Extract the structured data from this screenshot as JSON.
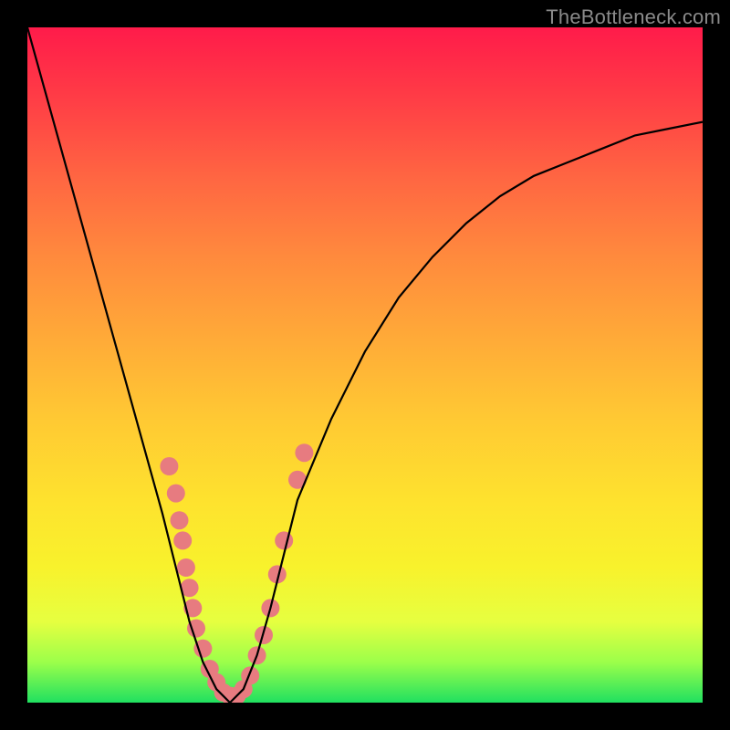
{
  "watermark": "TheBottleneck.com",
  "chart_data": {
    "type": "line",
    "title": "",
    "xlabel": "",
    "ylabel": "",
    "xlim": [
      0,
      100
    ],
    "ylim": [
      0,
      100
    ],
    "x": [
      0,
      5,
      10,
      15,
      20,
      22,
      24,
      26,
      28,
      30,
      32,
      34,
      36,
      38,
      40,
      45,
      50,
      55,
      60,
      65,
      70,
      75,
      80,
      85,
      90,
      95,
      100
    ],
    "series": [
      {
        "name": "bottleneck-curve",
        "values": [
          100,
          82,
          64,
          46,
          28,
          20,
          12,
          6,
          2,
          0,
          2,
          7,
          14,
          22,
          30,
          42,
          52,
          60,
          66,
          71,
          75,
          78,
          80,
          82,
          84,
          85,
          86
        ]
      }
    ],
    "markers": {
      "name": "highlighted-points",
      "points": [
        {
          "x": 21,
          "y": 35
        },
        {
          "x": 22,
          "y": 31
        },
        {
          "x": 22.5,
          "y": 27
        },
        {
          "x": 23,
          "y": 24
        },
        {
          "x": 23.5,
          "y": 20
        },
        {
          "x": 24,
          "y": 17
        },
        {
          "x": 24.5,
          "y": 14
        },
        {
          "x": 25,
          "y": 11
        },
        {
          "x": 26,
          "y": 8
        },
        {
          "x": 27,
          "y": 5
        },
        {
          "x": 28,
          "y": 3
        },
        {
          "x": 29,
          "y": 1.5
        },
        {
          "x": 30,
          "y": 1
        },
        {
          "x": 31,
          "y": 1
        },
        {
          "x": 32,
          "y": 2
        },
        {
          "x": 33,
          "y": 4
        },
        {
          "x": 34,
          "y": 7
        },
        {
          "x": 35,
          "y": 10
        },
        {
          "x": 36,
          "y": 14
        },
        {
          "x": 37,
          "y": 19
        },
        {
          "x": 38,
          "y": 24
        },
        {
          "x": 40,
          "y": 33
        },
        {
          "x": 41,
          "y": 37
        }
      ]
    },
    "min_index": 7,
    "colors": {
      "curve": "#000000",
      "marker": "#e77b80",
      "background_top": "#ff1b4a",
      "background_bottom": "#20e060"
    }
  }
}
